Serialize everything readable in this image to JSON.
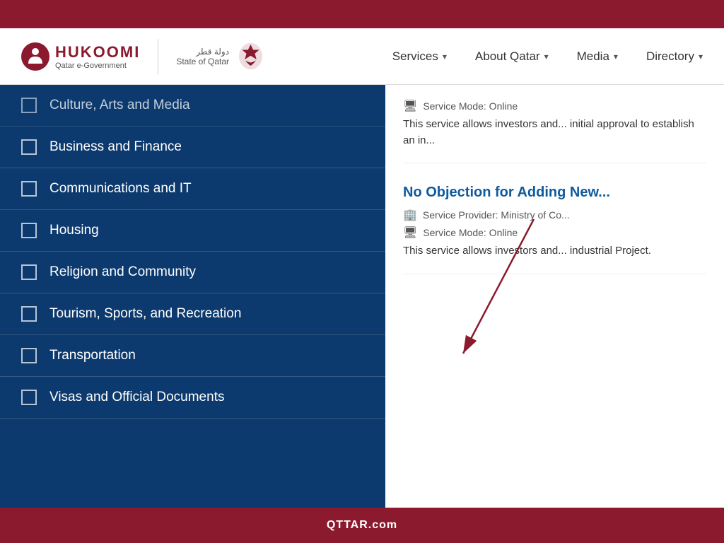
{
  "topBar": {},
  "header": {
    "logo": {
      "brandName": "HUKOOMI",
      "subText": "Qatar e-Government",
      "stateText": "دولة قطر\nState of Qatar"
    },
    "nav": [
      {
        "label": "Services",
        "hasDropdown": true
      },
      {
        "label": "About Qatar",
        "hasDropdown": true
      },
      {
        "label": "Media",
        "hasDropdown": true
      },
      {
        "label": "Directory",
        "hasDropdown": true
      }
    ]
  },
  "sidebar": {
    "items": [
      {
        "label": "Culture, Arts and Media",
        "checked": false,
        "faded": true
      },
      {
        "label": "Business and Finance",
        "checked": false
      },
      {
        "label": "Communications and IT",
        "checked": false
      },
      {
        "label": "Housing",
        "checked": false
      },
      {
        "label": "Religion and Community",
        "checked": false
      },
      {
        "label": "Tourism, Sports, and Recreation",
        "checked": false
      },
      {
        "label": "Transportation",
        "checked": false
      },
      {
        "label": "Visas and Official Documents",
        "checked": false
      }
    ]
  },
  "rightContent": {
    "cards": [
      {
        "providerLabel": "",
        "modeLabel": "Service Mode:  Online",
        "description": "This service allows investors and... initial approval to establish an in..."
      },
      {
        "title": "No Objection for Adding New...",
        "providerLabel": "Service Provider:  Ministry of Co...",
        "modeLabel": "Service Mode:  Online",
        "description": "This service allows investors and... industrial Project."
      }
    ]
  },
  "bottomBar": {
    "text": "QTTAR.com"
  }
}
